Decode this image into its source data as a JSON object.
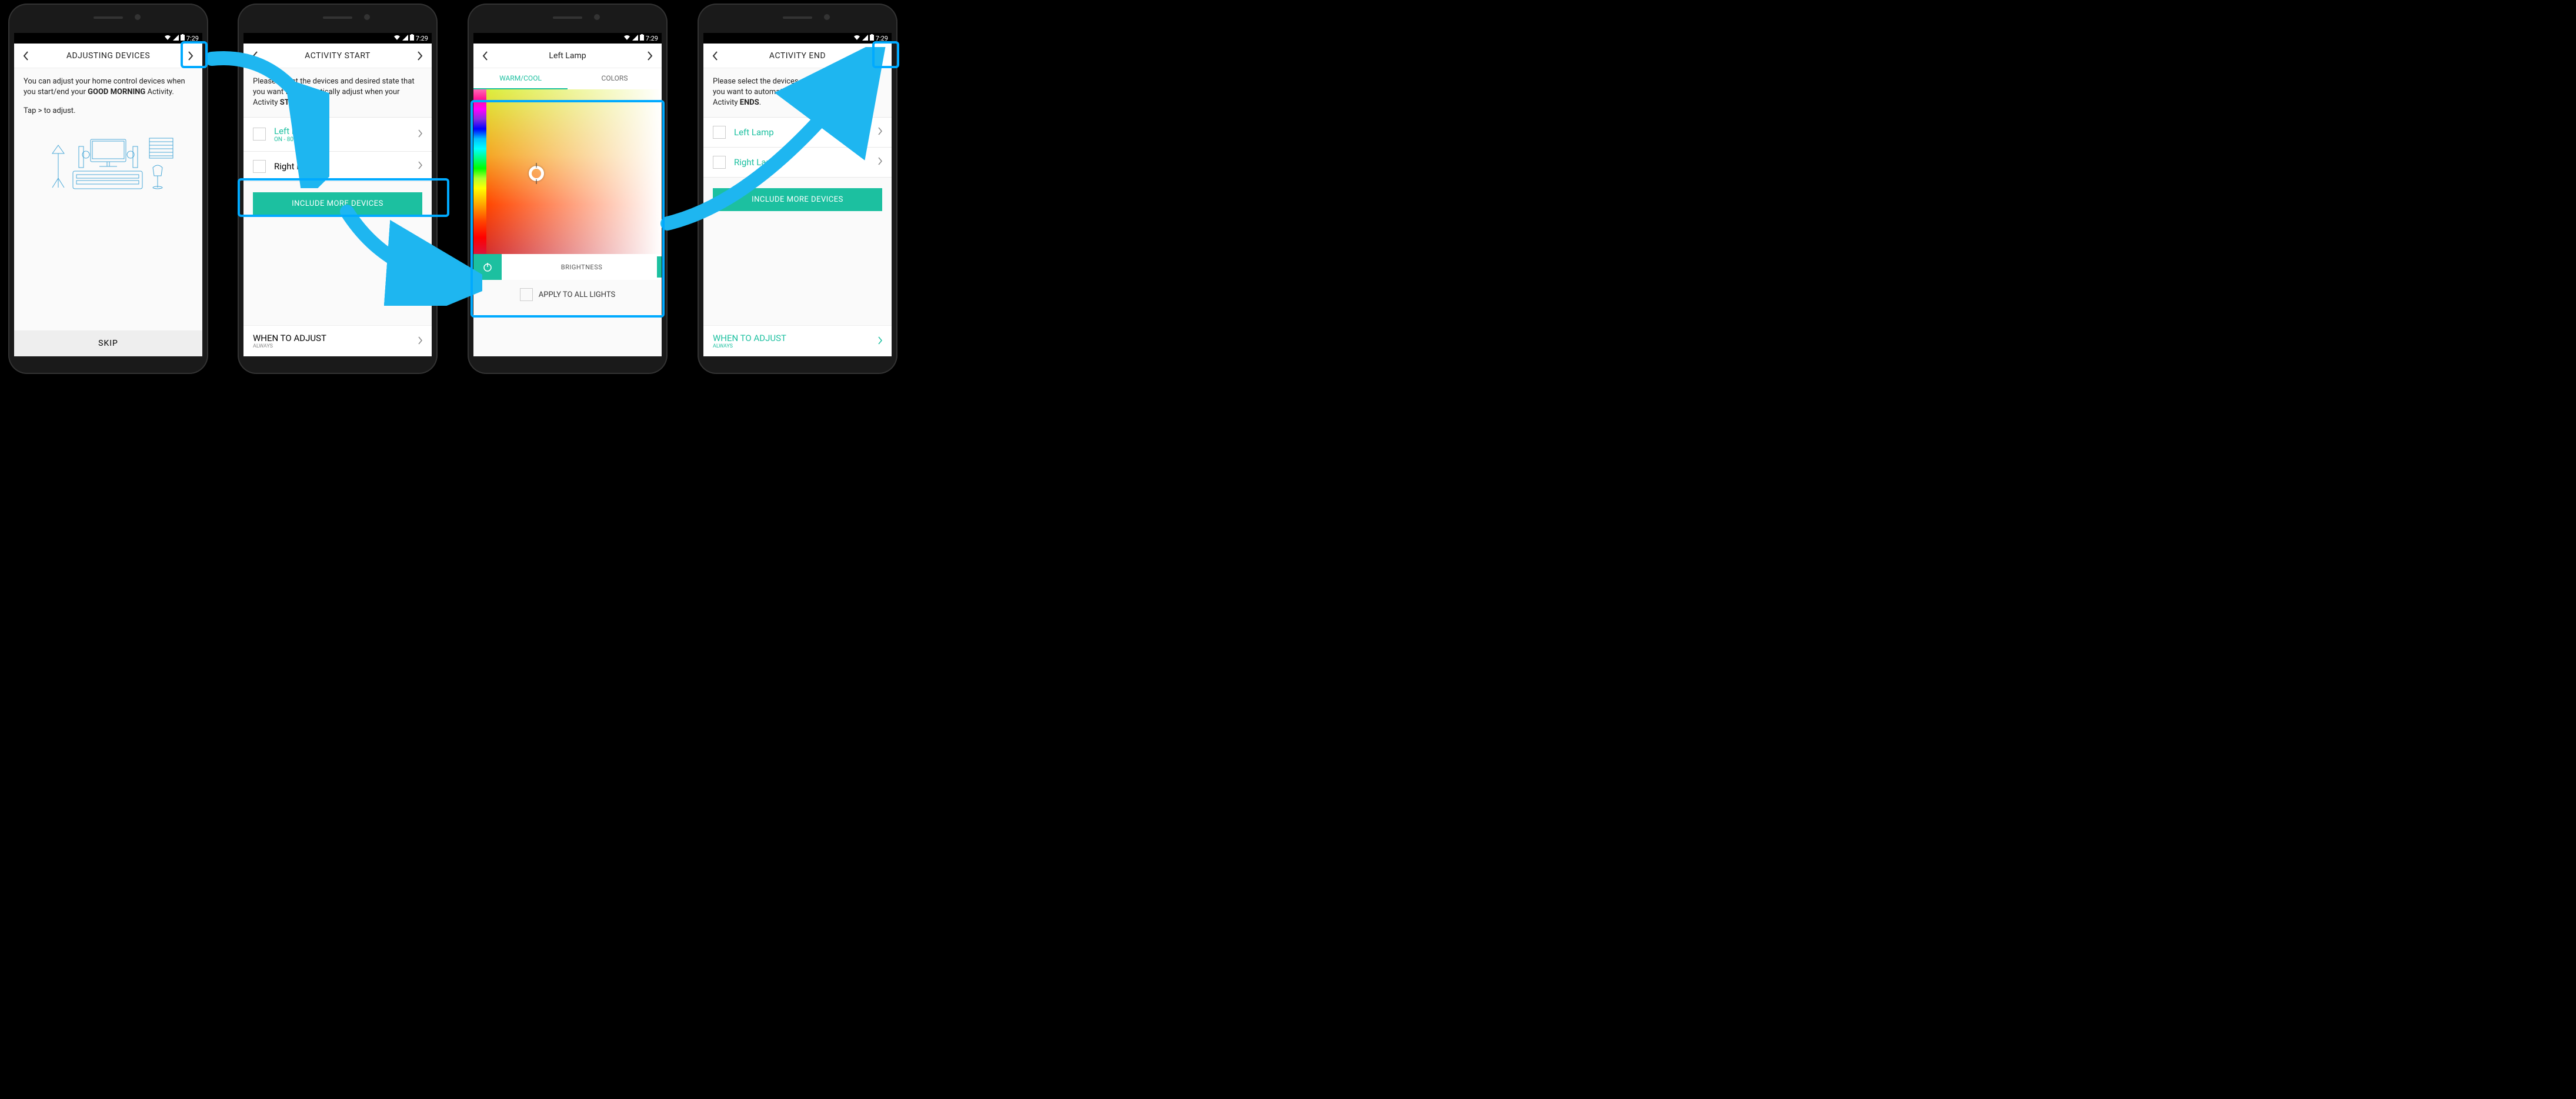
{
  "status": {
    "time": "7:29"
  },
  "screen1": {
    "title": "ADJUSTING DEVICES",
    "body_pre": "You can adjust your home control devices when you start/end your ",
    "body_bold": "GOOD MORNING",
    "body_post": " Activity.",
    "hint": "Tap > to adjust.",
    "skip": "SKIP"
  },
  "screen2": {
    "title": "ACTIVITY START",
    "body_pre": "Please select the devices and desired state that you want to automatically adjust when your Activity ",
    "body_bold": "STARTS",
    "body_post": ".",
    "device1": {
      "name": "Left Lamp",
      "sub": "ON  - 80%"
    },
    "device2": {
      "name": "Right Lamp"
    },
    "include": "INCLUDE MORE DEVICES",
    "when_title": "WHEN TO ADJUST",
    "when_sub": "ALWAYS"
  },
  "screen3": {
    "title": "Left Lamp",
    "tab1": "WARM/COOL",
    "tab2": "COLORS",
    "brightness": "BRIGHTNESS",
    "apply": "APPLY TO ALL LIGHTS"
  },
  "screen4": {
    "title": "ACTIVITY END",
    "body_pre": "Please select the devices and desired state that you want to automatically adjust when your Activity ",
    "body_bold": "ENDS",
    "body_post": ".",
    "device1": {
      "name": "Left Lamp"
    },
    "device2": {
      "name": "Right Lamp"
    },
    "include": "INCLUDE MORE DEVICES",
    "when_title": "WHEN TO ADJUST",
    "when_sub": "ALWAYS"
  }
}
